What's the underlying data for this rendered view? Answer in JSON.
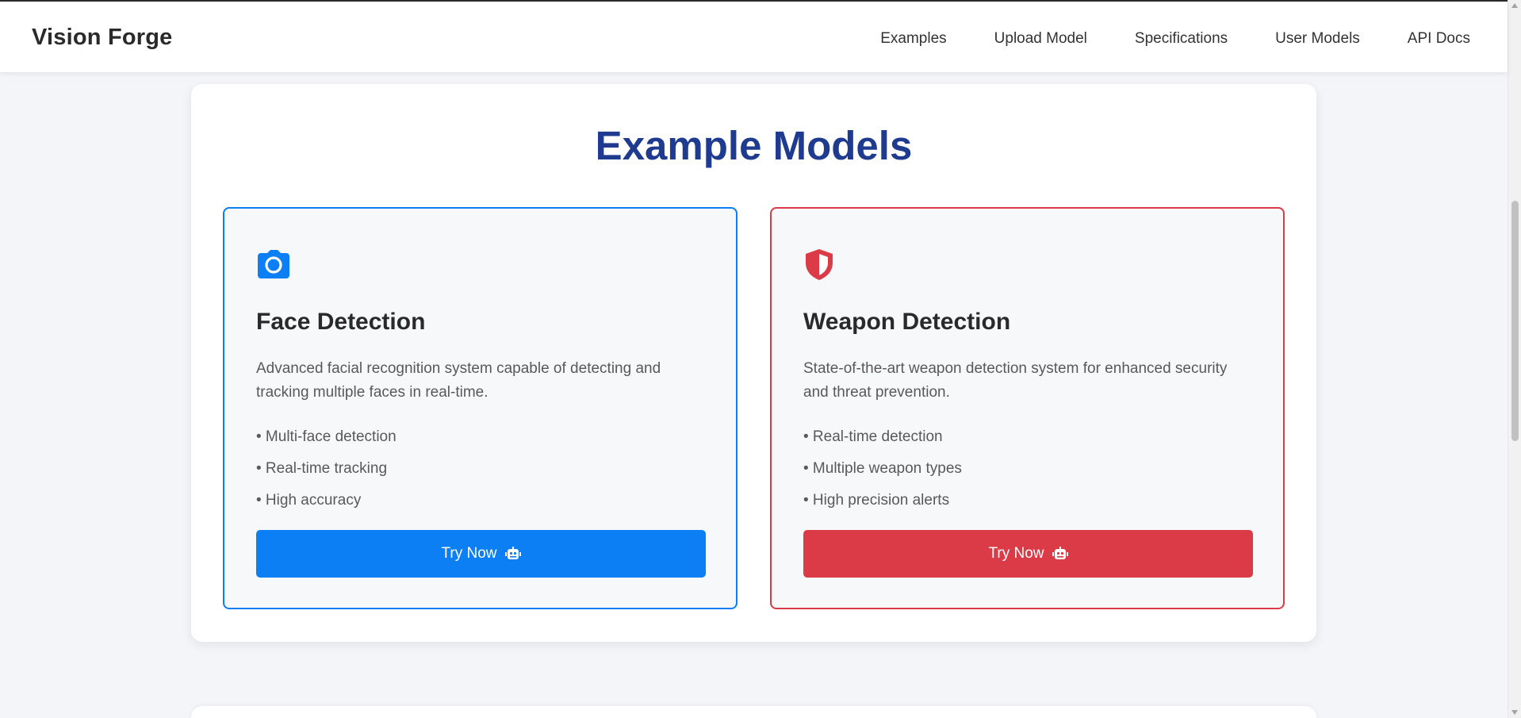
{
  "app": {
    "brand": "Vision Forge"
  },
  "nav": {
    "links": [
      "Examples",
      "Upload Model",
      "Specifications",
      "User Models",
      "API Docs"
    ]
  },
  "section": {
    "title": "Example Models"
  },
  "models": [
    {
      "title": "Face Detection",
      "icon": "camera-icon",
      "accent": "#0d7ff5",
      "description": "Advanced facial recognition system capable of detecting and tracking multiple faces in real-time.",
      "features": [
        "• Multi-face detection",
        "• Real-time tracking",
        "• High accuracy"
      ],
      "button_label": "Try Now",
      "button_icon": "robot-icon"
    },
    {
      "title": "Weapon Detection",
      "icon": "shield-icon",
      "accent": "#db3a47",
      "description": "State-of-the-art weapon detection system for enhanced security and threat prevention.",
      "features": [
        "• Real-time detection",
        "• Multiple weapon types",
        "• High precision alerts"
      ],
      "button_label": "Try Now",
      "button_icon": "robot-icon"
    }
  ],
  "colors": {
    "title": "#1f3b8f",
    "page_background": "#f3f5f8"
  }
}
